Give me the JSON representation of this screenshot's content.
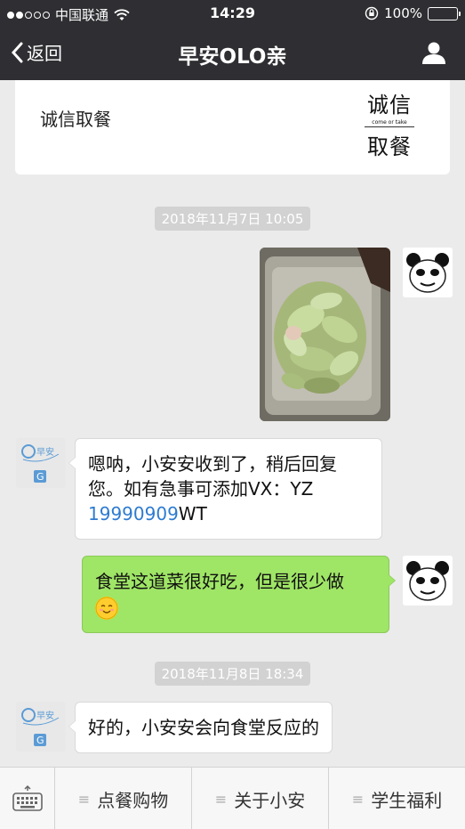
{
  "status": {
    "carrier": "中国联通",
    "time": "14:29",
    "battery": "100%",
    "signal_dots_filled": 2,
    "signal_dots_total": 5
  },
  "nav": {
    "back_label": "返回",
    "title": "早安OLO亲",
    "profile_icon": "person-icon"
  },
  "card": {
    "text": "诚信取餐",
    "logo_line1": "诚信",
    "logo_sub": "come or take",
    "logo_line2": "取餐"
  },
  "messages": [
    {
      "type": "timestamp",
      "text": "2018年11月7日 10:05"
    },
    {
      "type": "image",
      "side": "right",
      "avatar": "panda-meme-avatar",
      "content": "food-photo"
    },
    {
      "type": "text",
      "side": "left",
      "avatar": "bot-logo-avatar",
      "line1": "嗯呐，小安安收到了，稍后回复",
      "line2": "您。如有急事可添加VX：YZ",
      "link": "19990909",
      "suffix": "WT"
    },
    {
      "type": "text",
      "side": "right",
      "avatar": "panda-meme-avatar",
      "text": "食堂这道菜很好吃，但是很少做",
      "emoji": "smile-emoji"
    },
    {
      "type": "timestamp",
      "text": "2018年11月8日 18:34"
    },
    {
      "type": "text",
      "side": "left",
      "avatar": "bot-logo-avatar",
      "text": "好的，小安安会向食堂反应的"
    }
  ],
  "bottom_menu": {
    "keyboard_icon": "keyboard-icon",
    "items": [
      {
        "label": "点餐购物"
      },
      {
        "label": "关于小安"
      },
      {
        "label": "学生福利"
      }
    ]
  },
  "colors": {
    "nav_bg": "#2f2f33",
    "chat_bg": "#ebebeb",
    "out_bubble": "#9fe566",
    "link": "#2d7bd0"
  }
}
